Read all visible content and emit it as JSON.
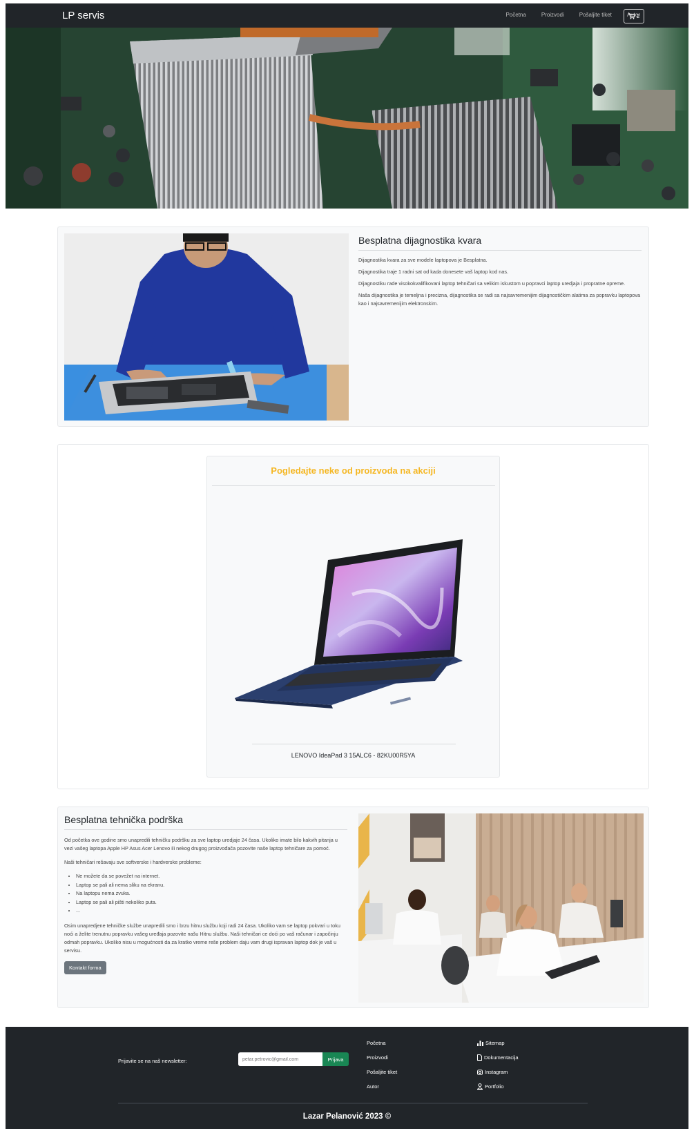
{
  "navbar": {
    "brand": "LP servis",
    "links": [
      "Početna",
      "Proizvodi",
      "Pošaljite tiket",
      "Autor"
    ],
    "cart_count": "2"
  },
  "diagnostics": {
    "title": "Besplatna dijagnostika kvara",
    "paragraphs": [
      "Dijagnostika kvara za sve modele laptopova je Besplatna.",
      "Dijagnostika traje 1 radni sat od kada donesete vaš laptop kod nas.",
      "Dijagnostiku rade visokokvalifikovani laptop tehničari sa velikim iskustom u popravci laptop uredjaja i propratne opreme.",
      "Naša dijagnostika je temeljna i precizna, dijagnostika se radi sa najsavremenijim dijagnostičkim alatima za popravku laptopova kao i najsavremenijim elektronskim."
    ]
  },
  "promo": {
    "title": "Pogledajte neke od proizvoda na akciji",
    "product_name": "LENOVO IdeaPad 3 15ALC6 - 82KU00R5YA"
  },
  "support": {
    "title": "Besplatna tehnička podrška",
    "intro": "Od početka ove godine smo unapredili tehničku podršku za sve laptop uredjaje 24 časa. Ukoliko imate bilo kakvih pitanja u vezi vašeg laptopa Apple HP Asus Acer Lenovo ili nekog drugog proizvođača pozovite naše laptop tehničare za pomoć.",
    "problems_heading": "Naši tehničari rešavaju sve softverske i hardverske probleme:",
    "problems": [
      "Ne možete da se povežet na internet.",
      "Laptop se pali ali nema sliku na ekranu.",
      "Na laptopu nema zvuka.",
      "Laptop se pali ali pišti nekoliko puta.",
      "..."
    ],
    "outro": "Osim unapredjene tehničke službe unapredili smo i brzu hitnu službu koji radi 24 časa. Ukoliko vam se laptop pokvari u toku noći a želite trenutnu popravku vašeg uređaja pozovite našu Hitnu službu. Naši tehničari ce doći po vaš računar i započinju odmah popravku. Ukoliko nisu u mogućnosti da za kratko vreme reše problem daju vam drugi ispravan laptop dok je vaš u servisu.",
    "button": "Kontakt forma"
  },
  "footer": {
    "newsletter_label": "Prijavite se na naš newsletter:",
    "newsletter_placeholder": "petar.petrovic@gmail.com",
    "newsletter_button": "Prijava",
    "links": [
      "Početna",
      "Proizvodi",
      "Pošaljite tiket",
      "Autor"
    ],
    "resources": [
      {
        "icon": "sitemap-icon",
        "label": "Sitemap"
      },
      {
        "icon": "document-icon",
        "label": "Dokumentacija"
      },
      {
        "icon": "instagram-icon",
        "label": "Instagram"
      },
      {
        "icon": "person-icon",
        "label": "Portfolio"
      }
    ],
    "copyright": "Lazar Pelanović 2023 ©"
  }
}
